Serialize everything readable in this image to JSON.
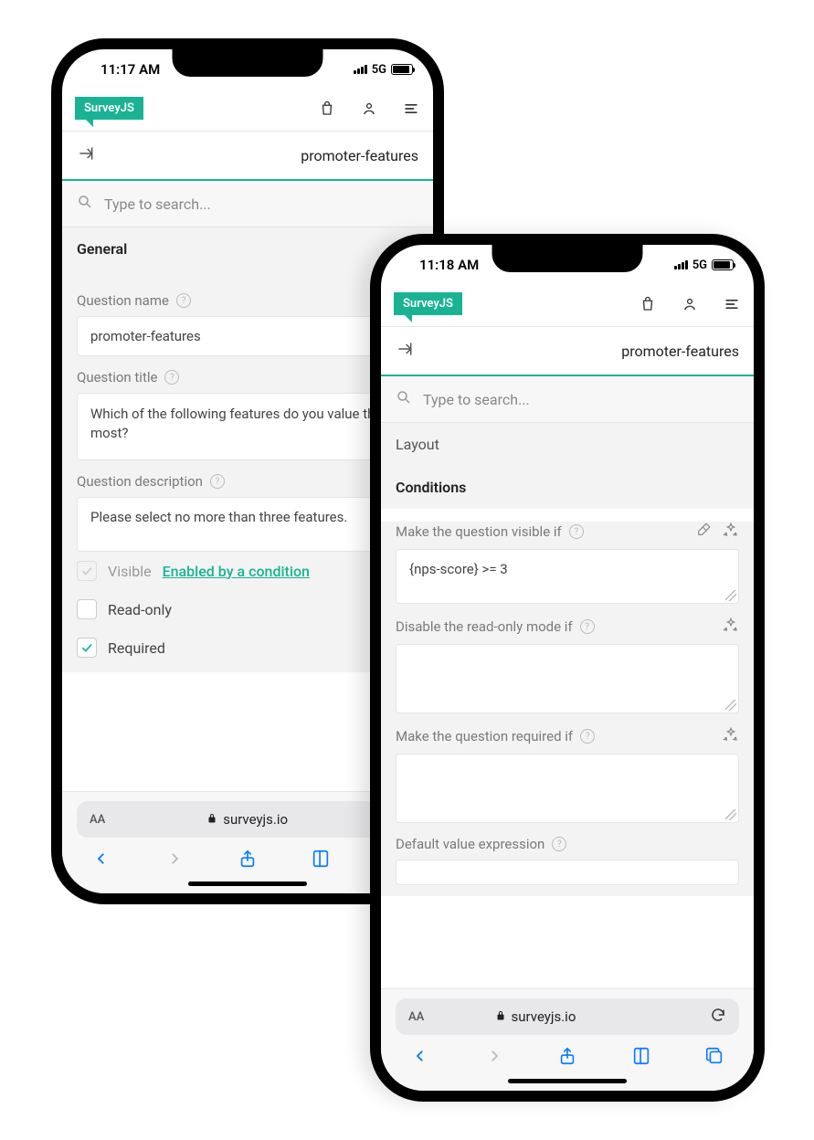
{
  "phone1": {
    "time": "11:17 AM",
    "network": "5G",
    "logo": "SurveyJS",
    "question_ref": "promoter-features",
    "search_placeholder": "Type to search...",
    "section_general": "General",
    "labels": {
      "name": "Question name",
      "title": "Question title",
      "description": "Question description"
    },
    "fields": {
      "name": "promoter-features",
      "title": "Which of the following features do you value the most?",
      "description": "Please select no more than three features."
    },
    "checks": {
      "visible_label": "Visible",
      "visible_link": "Enabled by a condition",
      "readonly_label": "Read-only",
      "required_label": "Required"
    },
    "url_host": "surveyjs.io"
  },
  "phone2": {
    "time": "11:18 AM",
    "network": "5G",
    "logo": "SurveyJS",
    "question_ref": "promoter-features",
    "search_placeholder": "Type to search...",
    "section_layout": "Layout",
    "section_conditions": "Conditions",
    "labels": {
      "visible_if": "Make the question visible if",
      "disable_readonly_if": "Disable the read-only mode if",
      "required_if": "Make the question required if",
      "default_expr": "Default value expression"
    },
    "fields": {
      "visible_if": "{nps-score} >= 3",
      "disable_readonly_if": "",
      "required_if": "",
      "default_expr": ""
    },
    "url_host": "surveyjs.io"
  }
}
